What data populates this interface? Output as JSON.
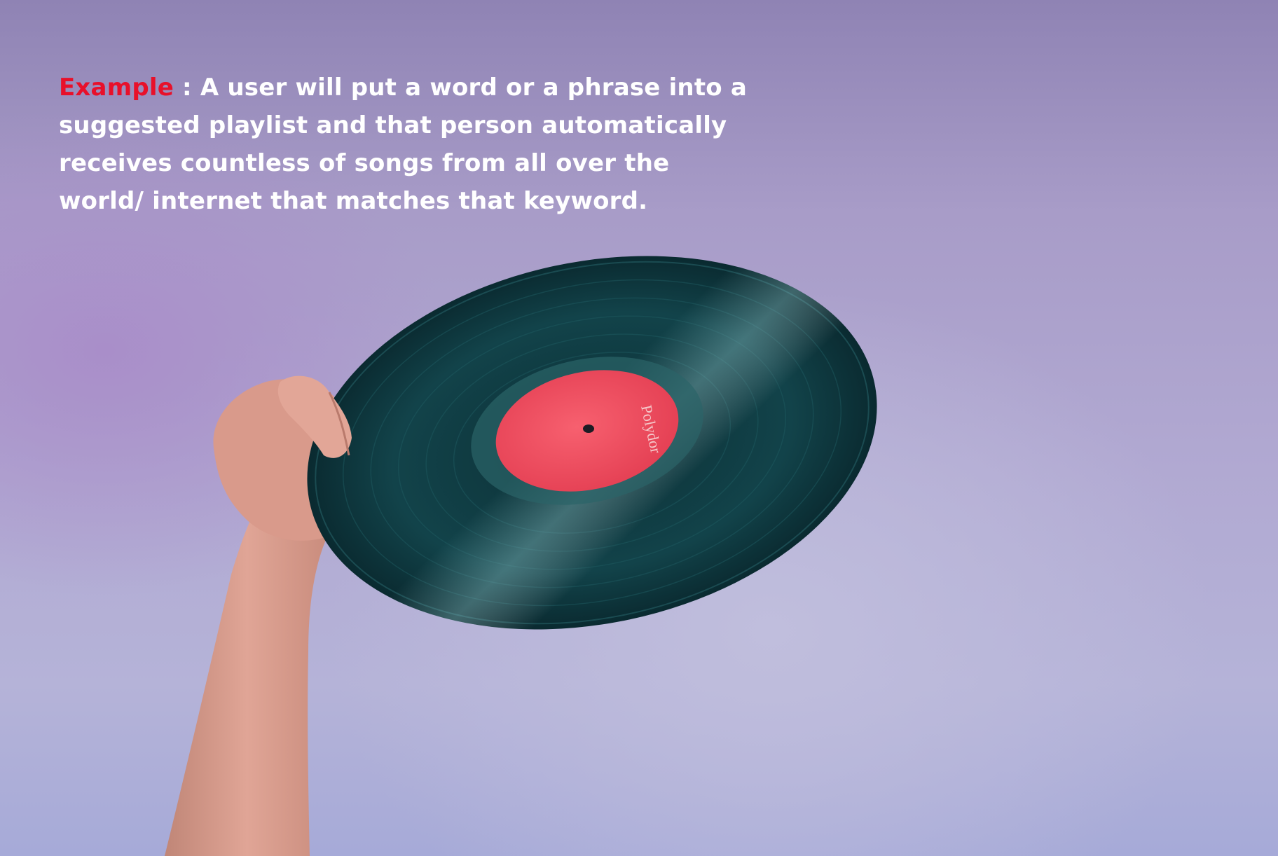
{
  "caption": {
    "lead": "Example",
    "text": " : A user will put a word or a phrase into a suggested playlist and that person automatically receives countless of songs from all over the world/ internet that matches that keyword."
  },
  "record_label": {
    "brand": "Polydor"
  },
  "colors": {
    "lead_highlight": "#e8102a",
    "caption_text": "#ffffff",
    "background": "#b1a9d2",
    "vinyl": "#0f3a3f",
    "label": "#f04a5c"
  }
}
